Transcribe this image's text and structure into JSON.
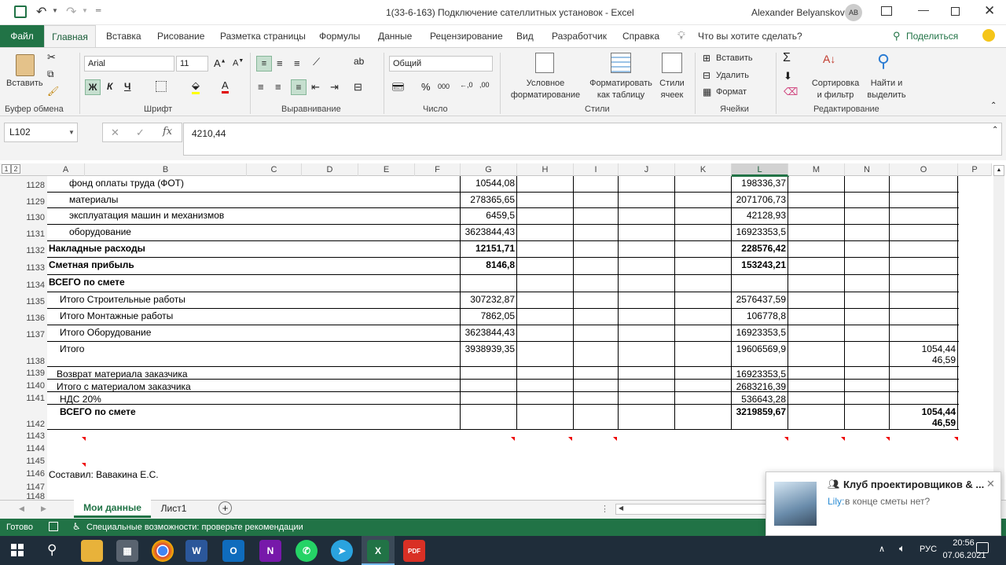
{
  "window": {
    "title": "1(33-6-163) Подключение сателлитных установок  -  Excel",
    "user": "Alexander Belyanskov",
    "avatar_initials": "AB"
  },
  "tabs": [
    "Файл",
    "Главная",
    "Вставка",
    "Рисование",
    "Разметка страницы",
    "Формулы",
    "Данные",
    "Рецензирование",
    "Вид",
    "Разработчик",
    "Справка"
  ],
  "tell_me": "Что вы хотите сделать?",
  "share": "Поделиться",
  "ribbon": {
    "paste": "Вставить",
    "clipboard": "Буфер обмена",
    "font_name": "Arial",
    "font_size": "11",
    "bold": "Ж",
    "italic": "К",
    "underline": "Ч",
    "font_group": "Шрифт",
    "align_group": "Выравнивание",
    "number_format": "Общий",
    "number_group": "Число",
    "cond_format_1": "Условное",
    "cond_format_2": "форматирование",
    "format_table_1": "Форматировать",
    "format_table_2": "как таблицу",
    "cell_styles_1": "Стили",
    "cell_styles_2": "ячеек",
    "styles_group": "Стили",
    "insert": "Вставить",
    "delete": "Удалить",
    "format": "Формат",
    "cells_group": "Ячейки",
    "sort_1": "Сортировка",
    "sort_2": "и фильтр",
    "find_1": "Найти и",
    "find_2": "выделить",
    "editing_group": "Редактирование"
  },
  "formula": {
    "namebox": "L102",
    "value": "4210,44"
  },
  "outline_levels": [
    "1",
    "2"
  ],
  "columns": [
    "A",
    "B",
    "C",
    "D",
    "E",
    "F",
    "G",
    "H",
    "I",
    "J",
    "K",
    "L",
    "M",
    "N",
    "O",
    "P"
  ],
  "rows": [
    {
      "n": "1128",
      "label": "фонд оплаты труда (ФОТ)",
      "g": "10544,08",
      "l": "198336,37",
      "o": ""
    },
    {
      "n": "1129",
      "label": "материалы",
      "g": "278365,65",
      "l": "2071706,73",
      "o": ""
    },
    {
      "n": "1130",
      "label": "эксплуатация машин и механизмов",
      "g": "6459,5",
      "l": "42128,93",
      "o": ""
    },
    {
      "n": "1131",
      "label": "оборудование",
      "g": "3623844,43",
      "l": "16923353,5",
      "o": ""
    },
    {
      "n": "1132",
      "label": "Накладные расходы",
      "g": "12151,71",
      "l": "228576,42",
      "o": ""
    },
    {
      "n": "1133",
      "label": "Сметная прибыль",
      "g": "8146,8",
      "l": "153243,21",
      "o": ""
    },
    {
      "n": "1134",
      "label": "ВСЕГО по смете",
      "g": "",
      "l": "",
      "o": ""
    },
    {
      "n": "1135",
      "label": "Итого Строительные работы",
      "g": "307232,87",
      "l": "2576437,59",
      "o": ""
    },
    {
      "n": "1136",
      "label": "Итого Монтажные работы",
      "g": "7862,05",
      "l": "106778,8",
      "o": ""
    },
    {
      "n": "1137",
      "label": "Итого Оборудование",
      "g": "3623844,43",
      "l": "16923353,5",
      "o": ""
    },
    {
      "n": "1138",
      "label": "Итого",
      "g": "3938939,35",
      "l": "19606569,9",
      "o": "1054,44",
      "o2": "46,59"
    },
    {
      "n": "1139",
      "label": "Возврат материала заказчика",
      "g": "",
      "l": "16923353,5",
      "o": ""
    },
    {
      "n": "1140",
      "label": "Итого с материалом заказчика",
      "g": "",
      "l": "2683216,39",
      "o": ""
    },
    {
      "n": "1141",
      "label": "НДС 20%",
      "g": "",
      "l": "536643,28",
      "o": ""
    },
    {
      "n": "1142",
      "label": "ВСЕГО по смете",
      "g": "",
      "l": "3219859,67",
      "o": "1054,44",
      "o2": "46,59"
    },
    {
      "n": "1143",
      "label": "",
      "g": "",
      "l": "",
      "o": ""
    },
    {
      "n": "1144",
      "label": "",
      "g": "",
      "l": "",
      "o": ""
    },
    {
      "n": "1145",
      "label": "",
      "g": "",
      "l": "",
      "o": ""
    },
    {
      "n": "1146",
      "label": "Составил: Вавакина Е.С.",
      "g": "",
      "l": "",
      "o": ""
    },
    {
      "n": "1147",
      "label": "",
      "g": "",
      "l": "",
      "o": ""
    },
    {
      "n": "1148",
      "label": "",
      "g": "",
      "l": "",
      "o": ""
    }
  ],
  "sheets": [
    "Мои данные",
    "Лист1"
  ],
  "status": {
    "ready": "Готово",
    "accessibility": "Специальные возможности: проверьте рекомендации"
  },
  "notification": {
    "title": "Клуб проектировщиков & ...",
    "sender": "Lily:",
    "message": "в конце сметы нет?"
  },
  "taskbar": {
    "lang": "РУС",
    "time": "20:56",
    "date": "07.06.2021"
  },
  "colors": {
    "excel_green": "#217346",
    "taskbar": "#1f2d3a"
  }
}
